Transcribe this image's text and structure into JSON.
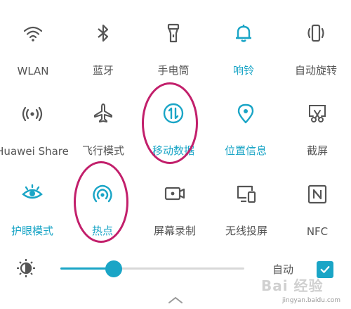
{
  "colors": {
    "accent": "#1aa5c6",
    "inactive": "#555555",
    "annotation": "#c21f6b"
  },
  "tiles": [
    {
      "label": "WLAN",
      "icon": "wifi-icon",
      "active": false
    },
    {
      "label": "蓝牙",
      "icon": "bluetooth-icon",
      "active": false
    },
    {
      "label": "手电筒",
      "icon": "flashlight-icon",
      "active": false
    },
    {
      "label": "响铃",
      "icon": "bell-icon",
      "active": true
    },
    {
      "label": "自动旋转",
      "icon": "auto-rotate-icon",
      "active": false
    },
    {
      "label": "Huawei Share",
      "icon": "huawei-share-icon",
      "active": false
    },
    {
      "label": "飞行模式",
      "icon": "airplane-icon",
      "active": false
    },
    {
      "label": "移动数据",
      "icon": "mobile-data-icon",
      "active": true
    },
    {
      "label": "位置信息",
      "icon": "location-icon",
      "active": true
    },
    {
      "label": "截屏",
      "icon": "screenshot-icon",
      "active": false
    },
    {
      "label": "护眼模式",
      "icon": "eye-icon",
      "active": true
    },
    {
      "label": "热点",
      "icon": "hotspot-icon",
      "active": true
    },
    {
      "label": "屏幕录制",
      "icon": "screen-record-icon",
      "active": false
    },
    {
      "label": "无线投屏",
      "icon": "cast-icon",
      "active": false
    },
    {
      "label": "NFC",
      "icon": "nfc-icon",
      "active": false
    }
  ],
  "brightness": {
    "level_percent": 29,
    "auto_label": "自动",
    "auto_checked": true
  },
  "watermark": {
    "text": "Bai 经验",
    "url": "jingyan.baidu.com"
  }
}
